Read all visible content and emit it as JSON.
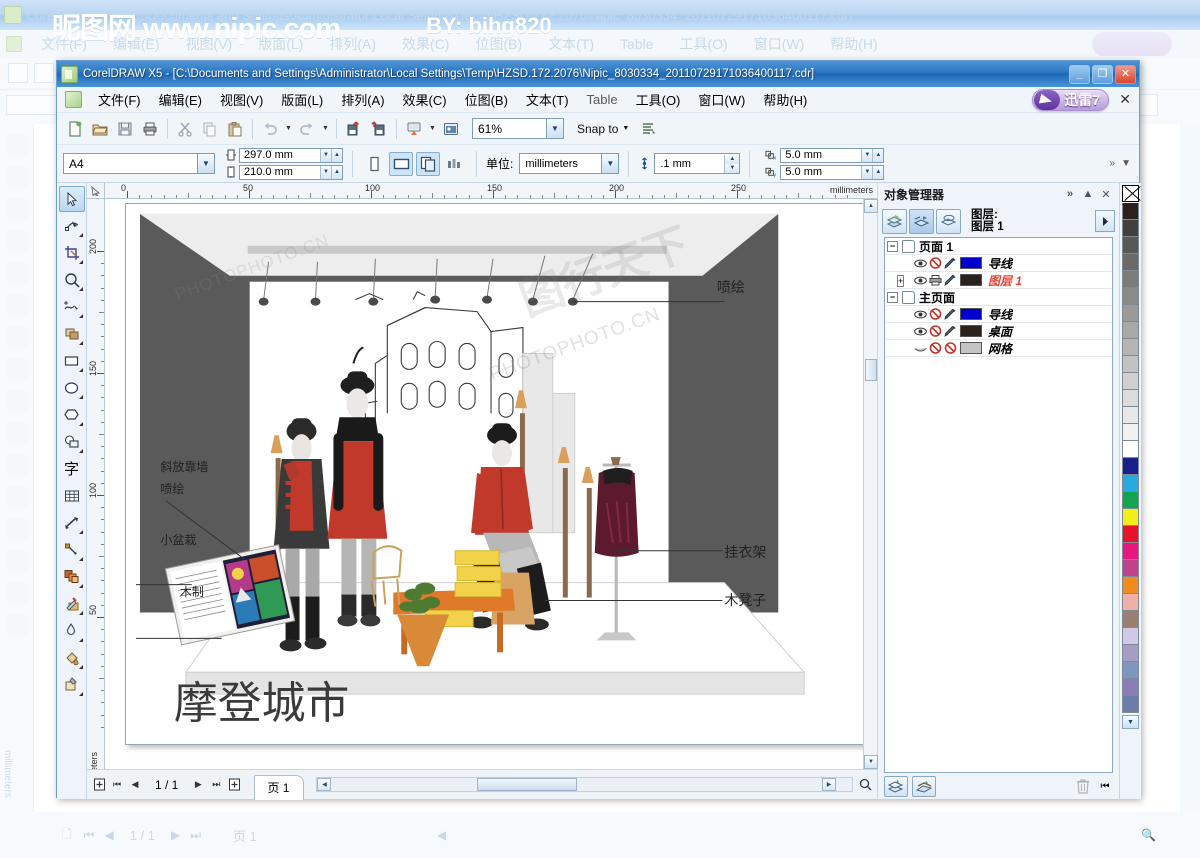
{
  "window": {
    "title": "CorelDRAW X5 - [C:\\Documents and Settings\\Administrator\\Local Settings\\Temp\\HZSD.172.2076\\Nipic_8030334_20110729171036400117.cdr]",
    "minimize": "_",
    "maximize": "❐",
    "close": "✕"
  },
  "watermark": {
    "left": "昵图网  www.nipic.com",
    "right": "BY: bihg820"
  },
  "menubar": {
    "items": [
      {
        "label": "文件(F)",
        "name": "menu-file"
      },
      {
        "label": "编辑(E)",
        "name": "menu-edit"
      },
      {
        "label": "视图(V)",
        "name": "menu-view"
      },
      {
        "label": "版面(L)",
        "name": "menu-layout"
      },
      {
        "label": "排列(A)",
        "name": "menu-arrange"
      },
      {
        "label": "效果(C)",
        "name": "menu-effects"
      },
      {
        "label": "位图(B)",
        "name": "menu-bitmaps"
      },
      {
        "label": "文本(T)",
        "name": "menu-text"
      },
      {
        "label": "Table",
        "name": "menu-table"
      },
      {
        "label": "工具(O)",
        "name": "menu-tools"
      },
      {
        "label": "窗口(W)",
        "name": "menu-window"
      },
      {
        "label": "帮助(H)",
        "name": "menu-help"
      }
    ],
    "xunlei_label": "迅雷7",
    "close_doc": "✕"
  },
  "toolbar": {
    "buttons": [
      {
        "name": "new-document-button",
        "icon": "new-file-icon"
      },
      {
        "name": "open-document-button",
        "icon": "open-folder-icon"
      },
      {
        "name": "save-document-button",
        "icon": "floppy-save-icon"
      },
      {
        "name": "print-button",
        "icon": "printer-icon"
      },
      {
        "name": "cut-button",
        "icon": "scissors-icon"
      },
      {
        "name": "copy-button",
        "icon": "copy-icon"
      },
      {
        "name": "paste-button",
        "icon": "clipboard-paste-icon"
      },
      {
        "name": "undo-button",
        "icon": "undo-arrow-icon"
      },
      {
        "name": "redo-button",
        "icon": "redo-arrow-icon"
      },
      {
        "name": "import-button",
        "icon": "import-icon"
      },
      {
        "name": "export-button",
        "icon": "export-icon"
      },
      {
        "name": "publish-pdf-button",
        "icon": "publish-pdf-icon"
      },
      {
        "name": "application-launcher-button",
        "icon": "app-launcher-icon"
      }
    ],
    "zoom_level": "61%",
    "snap_to_label": "Snap to",
    "options_icon": "options-icon"
  },
  "propertybar": {
    "page_size": "A4",
    "page_width": "297.0 mm",
    "page_height": "210.0 mm",
    "orientation_portrait": "portrait-icon",
    "orientation_landscape": "landscape-icon",
    "all_pages_icon": "all-pages-icon",
    "current_page_icon": "current-page-icon",
    "units_label": "单位:",
    "units_value": "millimeters",
    "nudge_value": ".1 mm",
    "duplicate_x": "5.0 mm",
    "duplicate_y": "5.0 mm"
  },
  "toolbox": [
    {
      "name": "pick-tool",
      "icon": "arrow-cursor-icon",
      "active": true
    },
    {
      "name": "shape-tool",
      "icon": "shape-node-icon",
      "active": false
    },
    {
      "name": "crop-tool",
      "icon": "crop-icon",
      "active": false
    },
    {
      "name": "zoom-tool",
      "icon": "magnifier-icon",
      "active": false
    },
    {
      "name": "freehand-tool",
      "icon": "freehand-curve-icon",
      "active": false
    },
    {
      "name": "smart-fill-tool",
      "icon": "smart-fill-icon",
      "active": false
    },
    {
      "name": "rectangle-tool",
      "icon": "rectangle-icon",
      "active": false
    },
    {
      "name": "ellipse-tool",
      "icon": "ellipse-icon",
      "active": false
    },
    {
      "name": "polygon-tool",
      "icon": "polygon-icon",
      "active": false
    },
    {
      "name": "basic-shapes-tool",
      "icon": "basic-shapes-icon",
      "active": false
    },
    {
      "name": "text-tool",
      "icon": "text-zi-icon",
      "active": false,
      "glyph": "字"
    },
    {
      "name": "table-tool",
      "icon": "table-grid-icon",
      "active": false
    },
    {
      "name": "dimension-tool",
      "icon": "dimension-line-icon",
      "active": false
    },
    {
      "name": "connector-tool",
      "icon": "connector-icon",
      "active": false
    },
    {
      "name": "blend-tool",
      "icon": "blend-shapes-icon",
      "active": false
    },
    {
      "name": "color-eyedropper-tool",
      "icon": "eyedropper-icon",
      "active": false
    },
    {
      "name": "outline-pen-tool",
      "icon": "outline-pen-icon",
      "active": false
    },
    {
      "name": "fill-tool",
      "icon": "paint-bucket-icon",
      "active": false
    },
    {
      "name": "interactive-fill-tool",
      "icon": "interactive-fill-icon",
      "active": false
    }
  ],
  "rulers": {
    "units_label": "millimeters",
    "h_labels": [
      "0",
      "50",
      "100",
      "150",
      "200",
      "250"
    ],
    "v_labels": [
      "200",
      "150",
      "100",
      "50"
    ]
  },
  "artwork": {
    "title_text": "摩登城市",
    "callouts": [
      {
        "name": "callout-penhui-top",
        "label": "喷绘"
      },
      {
        "name": "callout-guayijia",
        "label": "挂衣架"
      },
      {
        "name": "callout-mudengzi",
        "label": "木凳子"
      },
      {
        "name": "callout-xiefang-kaoqiang",
        "label": "斜放靠墙"
      },
      {
        "name": "callout-penhui-left",
        "label": "喷绘"
      },
      {
        "name": "callout-xiaopenzai",
        "label": "小盆栽"
      },
      {
        "name": "callout-muzhi",
        "label": "木制"
      }
    ],
    "watermarks": [
      "图行天下",
      "PHOTOPHOTO.CN"
    ]
  },
  "pagenav": {
    "add_page_start": "add-page-icon",
    "first": "⏮",
    "prev": "◀",
    "counter": "1 / 1",
    "next": "▶",
    "last": "⏭",
    "add_page_end": "add-page-icon",
    "tab_label": "页 1"
  },
  "docker": {
    "title": "对象管理器",
    "expand": "»",
    "collapse": "▲",
    "close": "✕",
    "layer_caption_line1": "图层:",
    "layer_caption_line2": "图层 1",
    "view_buttons": [
      {
        "name": "show-object-properties-button",
        "icon": "layers-props-icon",
        "on": false
      },
      {
        "name": "edit-across-layers-button",
        "icon": "edit-across-layers-icon",
        "on": true
      },
      {
        "name": "layer-manager-view-button",
        "icon": "layer-manager-icon",
        "on": false
      }
    ],
    "options_flyout": "options-flyout-icon",
    "tree": [
      {
        "name": "tree-group-page1",
        "type": "group",
        "expander": "−",
        "label": "页面 1",
        "icon": "page-icon"
      },
      {
        "name": "tree-layer-guide-page1",
        "type": "layer",
        "expander": "",
        "label": "导线",
        "color": "#0000cc",
        "red": false,
        "icons": [
          "eye-icon",
          "print-disabled-icon",
          "pen-icon"
        ]
      },
      {
        "name": "tree-layer-layer1",
        "type": "layer",
        "expander": "+",
        "label": "图层 1",
        "color": "#2b211d",
        "red": true,
        "icons": [
          "eye-icon",
          "printer-icon",
          "pen-icon"
        ]
      },
      {
        "name": "tree-group-masterpage",
        "type": "group",
        "expander": "−",
        "label": "主页面",
        "icon": "page-icon"
      },
      {
        "name": "tree-layer-guide-master",
        "type": "layer",
        "expander": "",
        "label": "导线",
        "color": "#0000cc",
        "red": false,
        "icons": [
          "eye-icon",
          "print-disabled-icon",
          "pen-icon"
        ]
      },
      {
        "name": "tree-layer-desktop",
        "type": "layer",
        "expander": "",
        "label": "桌面",
        "color": "#2b211d",
        "red": false,
        "icons": [
          "eye-icon",
          "print-disabled-icon",
          "pen-icon"
        ]
      },
      {
        "name": "tree-layer-grid",
        "type": "layer",
        "expander": "",
        "label": "网格",
        "color": "#c4c4c4",
        "red": false,
        "icons": [
          "eye-closed-icon",
          "print-disabled-icon",
          "pen-disabled-icon"
        ]
      }
    ],
    "footer": {
      "new_layer": "new-layer-icon",
      "new_master_layer": "new-master-layer-icon",
      "delete": "trash-icon",
      "end": "⏮"
    }
  },
  "palette": {
    "no_color_name": "no-color-swatch",
    "scroll_down": "▼",
    "colors": [
      "#2b211d",
      "#43403c",
      "#5a5854",
      "#6c6a67",
      "#7c7b78",
      "#8b8a87",
      "#9b9a97",
      "#a9a8a5",
      "#b6b5b2",
      "#c3c2c0",
      "#d0cfcd",
      "#dcdbd9",
      "#e8e7e6",
      "#f2f1f0",
      "#ffffff",
      "#1b1f8c",
      "#2aa8e0",
      "#14a450",
      "#f2ee1a",
      "#e8122a",
      "#e8177f",
      "#c0418c",
      "#f28b1e",
      "#f0b0a8",
      "#9a7f70",
      "#cfc8e6",
      "#a79cc4",
      "#7f96bf",
      "#8a7fb5",
      "#6c7ea8"
    ]
  },
  "background_window": {
    "title": "CorelDRAW X5 - [C:\\Documents and Settings\\Administrator\\Local Settings\\Temp\\HZSD.172.2076\\Nipic_8030334_20110729171036400117.cdr]",
    "page_counter": "1 / 1",
    "tab_label": "页 1",
    "ruler_units": "millimeters"
  }
}
